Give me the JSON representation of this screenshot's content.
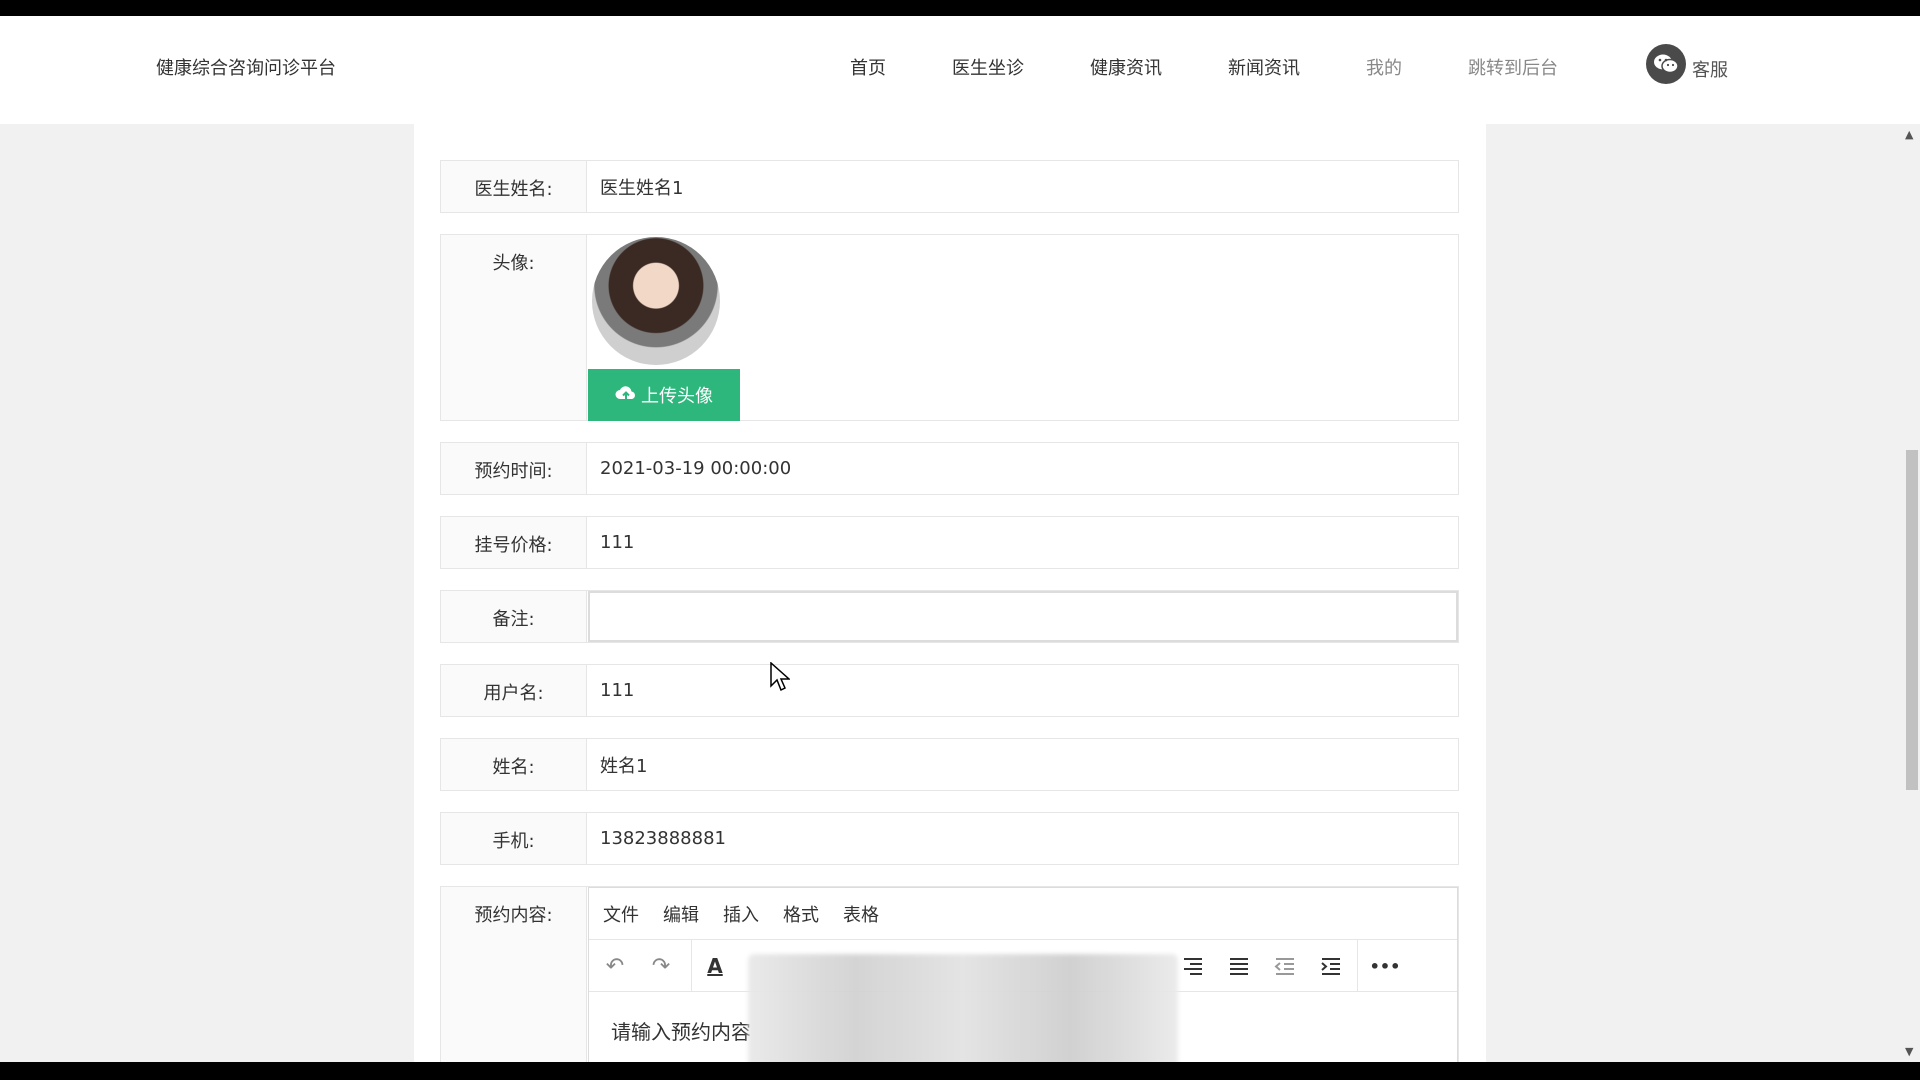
{
  "header": {
    "brand": "健康综合咨询问诊平台",
    "nav": [
      "首页",
      "医生坐诊",
      "健康资讯",
      "新闻资讯",
      "我的",
      "跳转到后台"
    ],
    "service_label": "客服"
  },
  "form": {
    "doctor_name": {
      "label": "医生姓名:",
      "value": "医生姓名1"
    },
    "avatar": {
      "label": "头像:",
      "upload_label": "上传头像"
    },
    "appointment_time": {
      "label": "预约时间:",
      "value": "2021-03-19 00:00:00"
    },
    "price": {
      "label": "挂号价格:",
      "value": "111"
    },
    "remark": {
      "label": "备注:",
      "value": ""
    },
    "username": {
      "label": "用户名:",
      "value": "111"
    },
    "name": {
      "label": "姓名:",
      "value": "姓名1"
    },
    "phone": {
      "label": "手机:",
      "value": "13823888881"
    },
    "content": {
      "label": "预约内容:",
      "placeholder": "请输入预约内容"
    }
  },
  "editor": {
    "menus": [
      "文件",
      "编辑",
      "插入",
      "格式",
      "表格"
    ],
    "more_label": "•••"
  }
}
